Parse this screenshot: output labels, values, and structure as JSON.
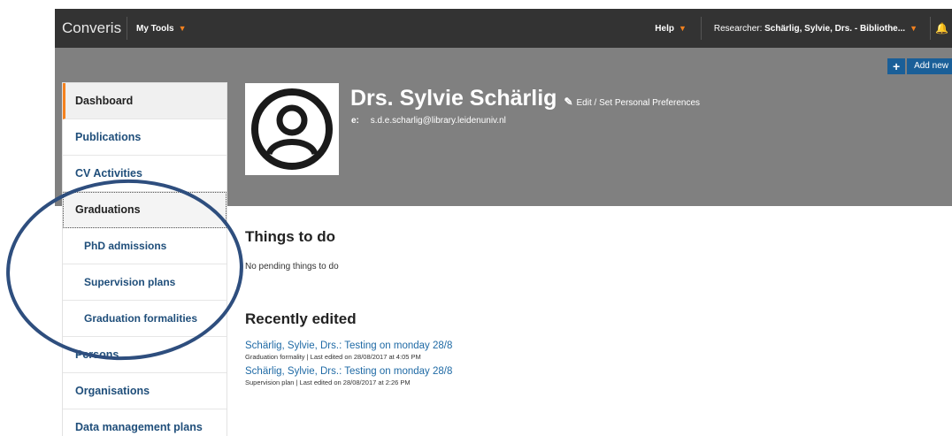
{
  "topbar": {
    "brand": "Converis",
    "my_tools": "My Tools",
    "help": "Help",
    "researcher_prefix": "Researcher:",
    "researcher_name": "Schärlig, Sylvie, Drs. - Bibliothe..."
  },
  "header": {
    "add_new": "Add new",
    "name": "Drs. Sylvie Schärlig",
    "edit_link": "Edit / Set Personal Preferences",
    "email_label": "e:",
    "email": "s.d.e.scharlig@library.leidenuniv.nl"
  },
  "sidebar": {
    "items": [
      {
        "label": "Dashboard"
      },
      {
        "label": "Publications"
      },
      {
        "label": "CV Activities"
      },
      {
        "label": "Graduations"
      },
      {
        "label": "PhD admissions"
      },
      {
        "label": "Supervision plans"
      },
      {
        "label": "Graduation formalities"
      },
      {
        "label": "Persons"
      },
      {
        "label": "Organisations"
      },
      {
        "label": "Data management plans"
      }
    ]
  },
  "main": {
    "todo_title": "Things to do",
    "todo_empty": "No pending things to do",
    "recent_title": "Recently edited",
    "recent": [
      {
        "title": "Schärlig, Sylvie, Drs.: Testing on monday 28/8",
        "meta": "Graduation formality | Last edited on 28/08/2017 at 4:05 PM"
      },
      {
        "title": "Schärlig, Sylvie, Drs.: Testing on monday 28/8",
        "meta": "Supervision plan | Last edited on 28/08/2017 at 2:26 PM"
      }
    ]
  },
  "colors": {
    "accent": "#f5821f",
    "link": "#1f6aa5",
    "topbar": "#333333",
    "banner": "#808080",
    "annotation": "#2e4e7e"
  },
  "icons": [
    "caret-down-icon",
    "bell-icon",
    "plus-icon",
    "pencil-icon",
    "user-avatar-icon"
  ]
}
